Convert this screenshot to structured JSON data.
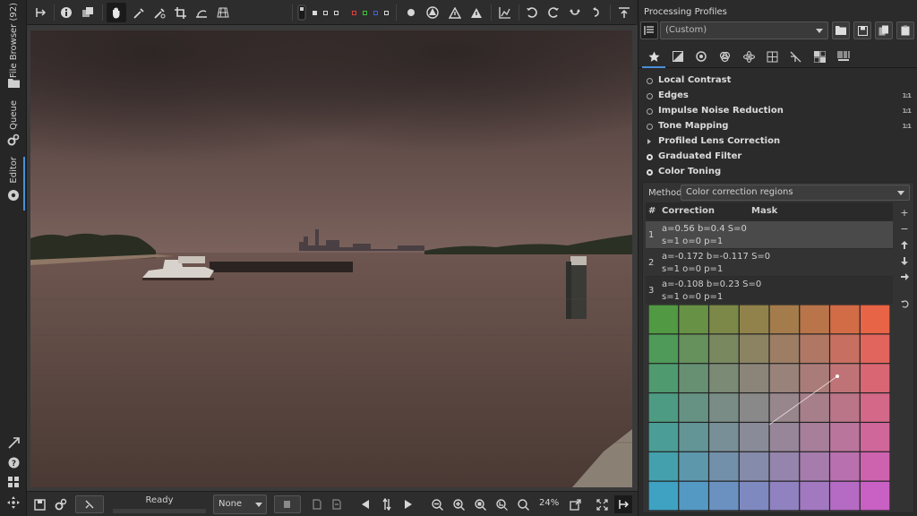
{
  "left_bar": {
    "tabs": [
      {
        "label": "File Browser (92)"
      },
      {
        "label": "Queue"
      },
      {
        "label": "Editor"
      }
    ]
  },
  "top_toolbar": {
    "tools": [
      "panel-toggle-icon",
      "info-icon",
      "before-after-icon",
      "hand-icon",
      "color-picker-icon",
      "white-balance-icon",
      "crop-icon",
      "straighten-icon",
      "perspective-icon"
    ],
    "indicator_colors": [
      "#d9d9d9",
      "#d9d9d9",
      "#d9d9d9",
      "#e04040",
      "#40c040",
      "#4060e0",
      "#d9d9d9"
    ]
  },
  "bottom_toolbar": {
    "status": "Ready",
    "profile_combo": "None",
    "zoom": "24%"
  },
  "right_panel": {
    "title": "Processing Profiles",
    "profile_value": "(Custom)",
    "tools": [
      {
        "name": "Local Contrast",
        "state": "off",
        "badge": ""
      },
      {
        "name": "Edges",
        "state": "off",
        "badge": "1:1"
      },
      {
        "name": "Impulse Noise Reduction",
        "state": "off",
        "badge": "1:1"
      },
      {
        "name": "Tone Mapping",
        "state": "off",
        "badge": "1:1"
      },
      {
        "name": "Profiled Lens Correction",
        "state": "collapsed",
        "badge": ""
      },
      {
        "name": "Graduated Filter",
        "state": "on",
        "badge": ""
      },
      {
        "name": "Color Toning",
        "state": "on",
        "badge": ""
      }
    ],
    "color_toning": {
      "method_label": "Method",
      "method_value": "Color correction regions",
      "table_headers": {
        "num": "#",
        "correction": "Correction",
        "mask": "Mask"
      },
      "regions": [
        {
          "num": "1",
          "line1": "a=0.56 b=0.4 S=0",
          "line2": "s=1 o=0 p=1"
        },
        {
          "num": "2",
          "line1": "a=-0.172 b=-0.117 S=0",
          "line2": "s=1 o=0 p=1"
        },
        {
          "num": "3",
          "line1": "a=-0.108 b=0.23 S=0",
          "line2": "s=1 o=0 p=1"
        }
      ]
    }
  }
}
